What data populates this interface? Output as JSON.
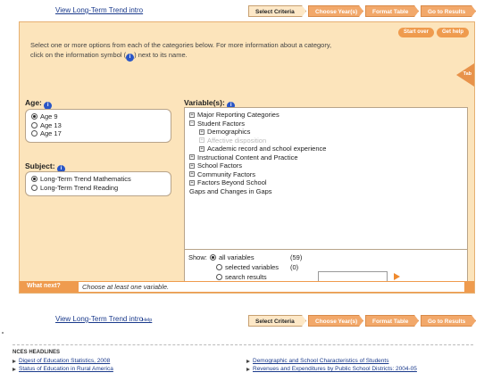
{
  "top_nav": {
    "intro_link": "View Long-Term Trend intro",
    "steps": [
      "Select Criteria",
      "Choose Year(s)",
      "Format Table",
      "Go to Results"
    ]
  },
  "panel": {
    "start_over": "Start over",
    "get_help": "Get help",
    "instructions_a": "Select one or more options from each of the categories below. For more information about a category,",
    "instructions_b": "click on the information symbol (",
    "instructions_c": ") next to its name.",
    "info_glyph": "i",
    "corner_tab_label": "Tab"
  },
  "age": {
    "label": "Age:",
    "options": [
      {
        "label": "Age 9",
        "selected": true
      },
      {
        "label": "Age 13",
        "selected": false
      },
      {
        "label": "Age 17",
        "selected": false
      }
    ]
  },
  "subject": {
    "label": "Subject:",
    "options": [
      {
        "label": "Long-Term Trend Mathematics",
        "selected": true
      },
      {
        "label": "Long-Term Trend Reading",
        "selected": false
      }
    ]
  },
  "variables": {
    "label": "Variable(s):",
    "tree": [
      {
        "label": "Major Reporting Categories",
        "toggle": "+"
      },
      {
        "label": "Student Factors",
        "toggle": "−"
      },
      {
        "label": "Demographics",
        "toggle": "+"
      },
      {
        "label": "Affective disposition",
        "toggle": "+"
      },
      {
        "label": "Academic record and school experience",
        "toggle": "+"
      },
      {
        "label": "Instructional Content and Practice",
        "toggle": "+"
      },
      {
        "label": "School Factors",
        "toggle": "+"
      },
      {
        "label": "Community Factors",
        "toggle": "+"
      },
      {
        "label": "Factors Beyond School",
        "toggle": "+"
      },
      {
        "label": "Gaps and Changes in Gaps",
        "toggle": ""
      }
    ],
    "show": {
      "label": "Show:",
      "all": "all variables",
      "all_count": "(59)",
      "selected": "selected variables",
      "selected_count": "(0)",
      "search": "search results"
    }
  },
  "what_next": {
    "label": "What next?",
    "message": "Choose at least one variable."
  },
  "bottom_nav": {
    "intro_link": "View Long-Term Trend intro",
    "small_link": "Help",
    "steps": [
      "Select Criteria",
      "Choose Year(s)",
      "Format Table",
      "Go to Results"
    ]
  },
  "footer": {
    "title": "NCES HEADLINES",
    "links": [
      "Digest of Education Statistics, 2008",
      "Status of Education in Rural America",
      "Demographic and School Characteristics of Students",
      "Revenues and Expenditures by Public School Districts: 2004-05"
    ]
  }
}
